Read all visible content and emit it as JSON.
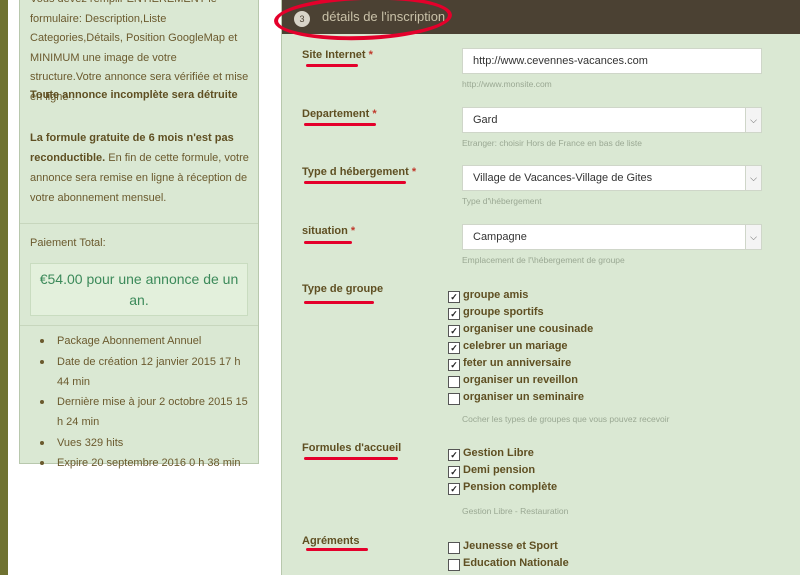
{
  "left_panel": {
    "intro": "Vous devez remplir ENTIEREMENT le formulaire: Description,Liste Categories,Détails, Position GoogleMap et MINIMUM une image de votre structure.Votre annonce sera vérifiée et mise en ligne .",
    "warning": "Toute annonce incomplète sera détruite",
    "formula_bold": "La formule gratuite de 6 mois n'est pas reconductible.",
    "formula_text": " En fin de cette formule, votre annonce sera remise en ligne à réception de votre abonnement mensuel.",
    "total_label": "Paiement Total:",
    "price": "€54.00 pour une annonce de un an.",
    "meta": [
      "Package Abonnement Annuel",
      "Date de création 12 janvier 2015 17 h 44 min",
      "Dernière mise à jour 2 octobre 2015 15 h 24 min",
      "Vues 329 hits",
      "Expire 20 septembre 2016 0 h 38 min"
    ]
  },
  "section": {
    "step": "3",
    "title": "détails de l'inscription"
  },
  "fields": {
    "site": {
      "label": "Site Internet",
      "req": "*",
      "value": "http://www.cevennes-vacances.com",
      "hint": "http://www.monsite.com"
    },
    "departement": {
      "label": "Departement",
      "req": "*",
      "value": "Gard",
      "hint": "Etranger: choisir Hors de France en bas de liste"
    },
    "type_hebergement": {
      "label": "Type d hébergement",
      "req": "*",
      "value": "Village de Vacances-Village de Gites",
      "hint": "Type d'\\hébergement"
    },
    "situation": {
      "label": "situation",
      "req": "*",
      "value": "Campagne",
      "hint": "Emplacement de l'\\hébergement de groupe"
    },
    "type_groupe": {
      "label": "Type de groupe",
      "hint": "Cocher les types de groupes que vous pouvez recevoir",
      "options": [
        {
          "label": "groupe amis",
          "checked": true
        },
        {
          "label": "groupe sportifs",
          "checked": true
        },
        {
          "label": "organiser une cousinade",
          "checked": true
        },
        {
          "label": "celebrer un mariage",
          "checked": true
        },
        {
          "label": "feter un anniversaire",
          "checked": true
        },
        {
          "label": "organiser un reveillon",
          "checked": false
        },
        {
          "label": "organiser un seminaire",
          "checked": false
        }
      ]
    },
    "formules": {
      "label": "Formules d'accueil",
      "hint": "Gestion Libre - Restauration",
      "options": [
        {
          "label": "Gestion Libre",
          "checked": true
        },
        {
          "label": "Demi pension",
          "checked": true
        },
        {
          "label": "Pension complète",
          "checked": true
        }
      ]
    },
    "agrements": {
      "label": "Agréments",
      "options": [
        {
          "label": "Jeunesse et Sport",
          "checked": false
        },
        {
          "label": "Education Nationale",
          "checked": false
        }
      ]
    }
  },
  "glyphs": {
    "check": "✓",
    "chevron": "⌵"
  },
  "colors": {
    "accent_red": "#e4002b",
    "header": "#4b4133",
    "panel": "#dae8d3"
  }
}
